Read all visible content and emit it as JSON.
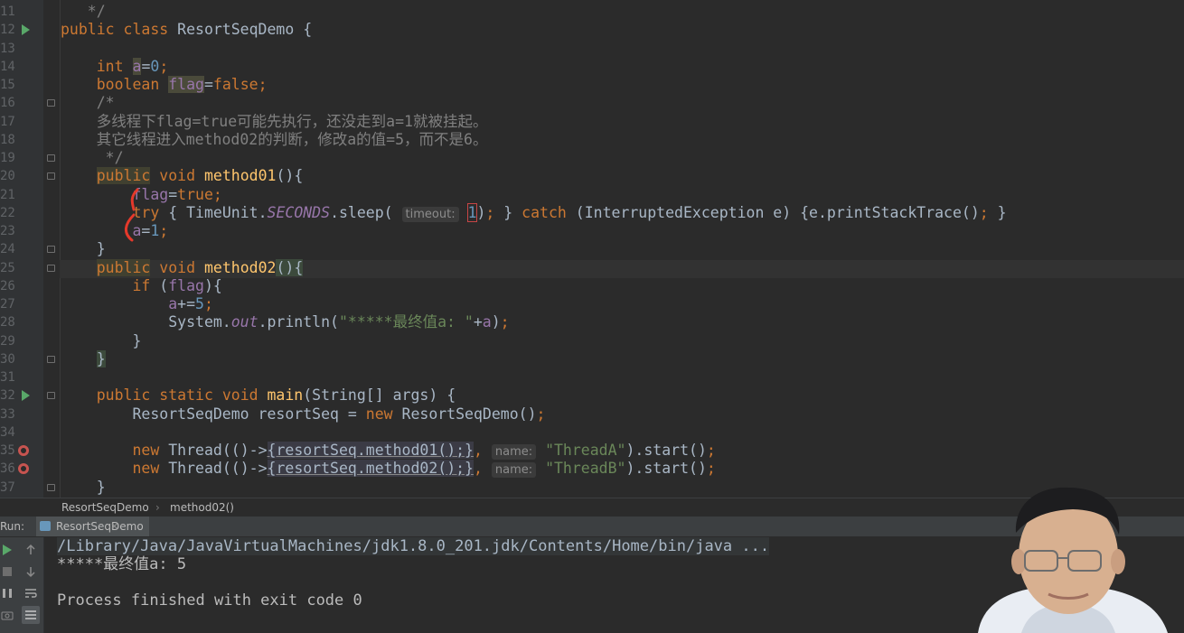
{
  "editor": {
    "lines": [
      {
        "num": "11",
        "segments": [
          {
            "t": "   */",
            "c": "cmt"
          }
        ]
      },
      {
        "num": "12",
        "segments": [
          {
            "t": "public class ",
            "c": "kw"
          },
          {
            "t": "ResortSeqDemo {",
            "c": ""
          }
        ]
      },
      {
        "num": "13",
        "segments": []
      },
      {
        "num": "14",
        "segments": [
          {
            "t": "    ",
            "c": ""
          },
          {
            "t": "int ",
            "c": "kw"
          },
          {
            "t": "a",
            "c": "fld hl-field"
          },
          {
            "t": "=",
            "c": ""
          },
          {
            "t": "0",
            "c": "num"
          },
          {
            "t": ";",
            "c": "kw"
          }
        ]
      },
      {
        "num": "15",
        "segments": [
          {
            "t": "    ",
            "c": ""
          },
          {
            "t": "boolean ",
            "c": "kw"
          },
          {
            "t": "flag",
            "c": "fld hl-field"
          },
          {
            "t": "=",
            "c": ""
          },
          {
            "t": "false",
            "c": "kw"
          },
          {
            "t": ";",
            "c": "kw"
          }
        ]
      },
      {
        "num": "16",
        "segments": [
          {
            "t": "    /*",
            "c": "cmt"
          }
        ]
      },
      {
        "num": "17",
        "segments": [
          {
            "t": "    多线程下flag=true可能先执行，还没走到a=1就被挂起。",
            "c": "cmt"
          }
        ]
      },
      {
        "num": "18",
        "segments": [
          {
            "t": "    其它线程进入method02的判断，修改a的值=5，而不是6。",
            "c": "cmt"
          }
        ]
      },
      {
        "num": "19",
        "segments": [
          {
            "t": "     */",
            "c": "cmt"
          }
        ]
      },
      {
        "num": "20",
        "segments": [
          {
            "t": "    ",
            "c": ""
          },
          {
            "t": "public",
            "c": "kw hl-decl"
          },
          {
            "t": " void ",
            "c": "kw"
          },
          {
            "t": "method01",
            "c": "fn"
          },
          {
            "t": "(){",
            "c": ""
          }
        ]
      },
      {
        "num": "21",
        "segments": [
          {
            "t": "        ",
            "c": ""
          },
          {
            "t": "flag",
            "c": "fld"
          },
          {
            "t": "=",
            "c": ""
          },
          {
            "t": "true",
            "c": "kw"
          },
          {
            "t": ";",
            "c": "kw"
          }
        ]
      },
      {
        "num": "22",
        "segments": [
          {
            "t": "        ",
            "c": ""
          },
          {
            "t": "try ",
            "c": "kw"
          },
          {
            "t": "{ TimeUnit.",
            "c": ""
          },
          {
            "t": "SECONDS",
            "c": "fld ital"
          },
          {
            "t": ".sleep( ",
            "c": ""
          },
          {
            "t": "timeout:",
            "c": "hint"
          },
          {
            "t": " ",
            "c": ""
          },
          {
            "t": "1",
            "c": "num boxed"
          },
          {
            "t": ")",
            "c": ""
          },
          {
            "t": "; ",
            "c": "kw"
          },
          {
            "t": "} ",
            "c": ""
          },
          {
            "t": "catch ",
            "c": "kw"
          },
          {
            "t": "(InterruptedException e) {e.printStackTrace()",
            "c": ""
          },
          {
            "t": "; ",
            "c": "kw"
          },
          {
            "t": "}",
            "c": ""
          }
        ]
      },
      {
        "num": "23",
        "segments": [
          {
            "t": "        ",
            "c": ""
          },
          {
            "t": "a",
            "c": "fld"
          },
          {
            "t": "=",
            "c": ""
          },
          {
            "t": "1",
            "c": "num"
          },
          {
            "t": ";",
            "c": "kw"
          }
        ]
      },
      {
        "num": "24",
        "segments": [
          {
            "t": "    }",
            "c": ""
          }
        ]
      },
      {
        "num": "25",
        "segments": [
          {
            "t": "    ",
            "c": ""
          },
          {
            "t": "public",
            "c": "kw hl-decl"
          },
          {
            "t": " void ",
            "c": "kw"
          },
          {
            "t": "method02",
            "c": "fn"
          },
          {
            "t": "()",
            "c": "hl-brace"
          },
          {
            "t": "{",
            "c": "hl-brace"
          }
        ]
      },
      {
        "num": "26",
        "segments": [
          {
            "t": "        ",
            "c": ""
          },
          {
            "t": "if ",
            "c": "kw"
          },
          {
            "t": "(",
            "c": ""
          },
          {
            "t": "flag",
            "c": "fld"
          },
          {
            "t": "){",
            "c": ""
          }
        ]
      },
      {
        "num": "27",
        "segments": [
          {
            "t": "            ",
            "c": ""
          },
          {
            "t": "a",
            "c": "fld"
          },
          {
            "t": "+=",
            "c": ""
          },
          {
            "t": "5",
            "c": "num"
          },
          {
            "t": ";",
            "c": "kw"
          }
        ]
      },
      {
        "num": "28",
        "segments": [
          {
            "t": "            System.",
            "c": ""
          },
          {
            "t": "out",
            "c": "fld ital"
          },
          {
            "t": ".println(",
            "c": ""
          },
          {
            "t": "\"*****最终值a: \"",
            "c": "str"
          },
          {
            "t": "+",
            "c": ""
          },
          {
            "t": "a",
            "c": "fld"
          },
          {
            "t": ")",
            "c": ""
          },
          {
            "t": ";",
            "c": "kw"
          }
        ]
      },
      {
        "num": "29",
        "segments": [
          {
            "t": "        }",
            "c": ""
          }
        ]
      },
      {
        "num": "30",
        "segments": [
          {
            "t": "    ",
            "c": ""
          },
          {
            "t": "}",
            "c": "hl-brace"
          }
        ]
      },
      {
        "num": "31",
        "segments": []
      },
      {
        "num": "32",
        "segments": [
          {
            "t": "    ",
            "c": ""
          },
          {
            "t": "public static void ",
            "c": "kw"
          },
          {
            "t": "main",
            "c": "fn"
          },
          {
            "t": "(String[] args) {",
            "c": ""
          }
        ]
      },
      {
        "num": "33",
        "segments": [
          {
            "t": "        ResortSeqDemo resortSeq = ",
            "c": ""
          },
          {
            "t": "new ",
            "c": "kw"
          },
          {
            "t": "ResortSeqDemo()",
            "c": ""
          },
          {
            "t": ";",
            "c": "kw"
          }
        ]
      },
      {
        "num": "34",
        "segments": []
      },
      {
        "num": "35",
        "segments": [
          {
            "t": "        ",
            "c": ""
          },
          {
            "t": "new ",
            "c": "kw"
          },
          {
            "t": "Thread(()->",
            "c": ""
          },
          {
            "t": "{resortSeq.method01();}",
            "c": "hl-lambda"
          },
          {
            "t": ", ",
            "c": "kw"
          },
          {
            "t": "name:",
            "c": "hint"
          },
          {
            "t": " ",
            "c": ""
          },
          {
            "t": "\"ThreadA\"",
            "c": "str"
          },
          {
            "t": ").start()",
            "c": ""
          },
          {
            "t": ";",
            "c": "kw"
          }
        ]
      },
      {
        "num": "36",
        "segments": [
          {
            "t": "        ",
            "c": ""
          },
          {
            "t": "new ",
            "c": "kw"
          },
          {
            "t": "Thread(()->",
            "c": ""
          },
          {
            "t": "{resortSeq.method02();}",
            "c": "hl-lambda"
          },
          {
            "t": ", ",
            "c": "kw"
          },
          {
            "t": "name:",
            "c": "hint"
          },
          {
            "t": " ",
            "c": ""
          },
          {
            "t": "\"ThreadB\"",
            "c": "str"
          },
          {
            "t": ").start()",
            "c": ""
          },
          {
            "t": ";",
            "c": "kw"
          }
        ]
      },
      {
        "num": "37",
        "segments": [
          {
            "t": "    }",
            "c": ""
          }
        ]
      }
    ]
  },
  "breadcrumb": {
    "class_name": "ResortSeqDemo",
    "method_name": "method02()"
  },
  "run_window": {
    "label": "Run:",
    "tab_label": "ResortSeqDemo",
    "close_symbol": "×",
    "console_lines": [
      "/Library/Java/JavaVirtualMachines/jdk1.8.0_201.jdk/Contents/Home/bin/java ...",
      "*****最终值a: 5",
      "",
      "Process finished with exit code 0"
    ]
  },
  "icons": {
    "rerun": "rerun-icon",
    "stop": "stop-icon",
    "pause": "pause-icon",
    "up": "scroll-up-icon",
    "down": "scroll-down-icon",
    "wrap": "soft-wrap-icon"
  },
  "colors": {
    "editor_bg": "#2b2b2b",
    "keyword": "#cc7832",
    "number": "#6897bb",
    "string": "#6a8759",
    "comment": "#808080",
    "field": "#9876aa",
    "method": "#ffc66d",
    "annotation_red": "#e5392b"
  }
}
